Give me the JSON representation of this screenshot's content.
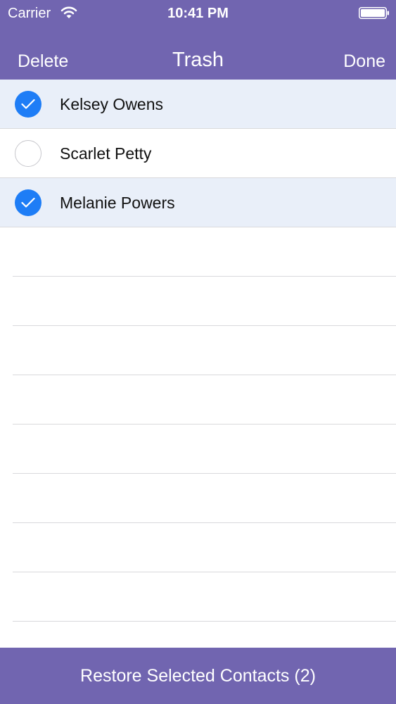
{
  "status_bar": {
    "carrier": "Carrier",
    "time": "10:41 PM",
    "wifi_icon": "wifi-icon",
    "battery_icon": "battery-icon"
  },
  "nav": {
    "left": "Delete",
    "title": "Trash",
    "right": "Done"
  },
  "contacts": [
    {
      "name": "Kelsey Owens",
      "selected": true
    },
    {
      "name": "Scarlet Petty",
      "selected": false
    },
    {
      "name": "Melanie Powers",
      "selected": true
    }
  ],
  "footer": {
    "label": "Restore Selected Contacts (2)"
  },
  "colors": {
    "header": "#7165b0",
    "accent": "#1e7df6",
    "selected_row": "#e9eff9"
  }
}
